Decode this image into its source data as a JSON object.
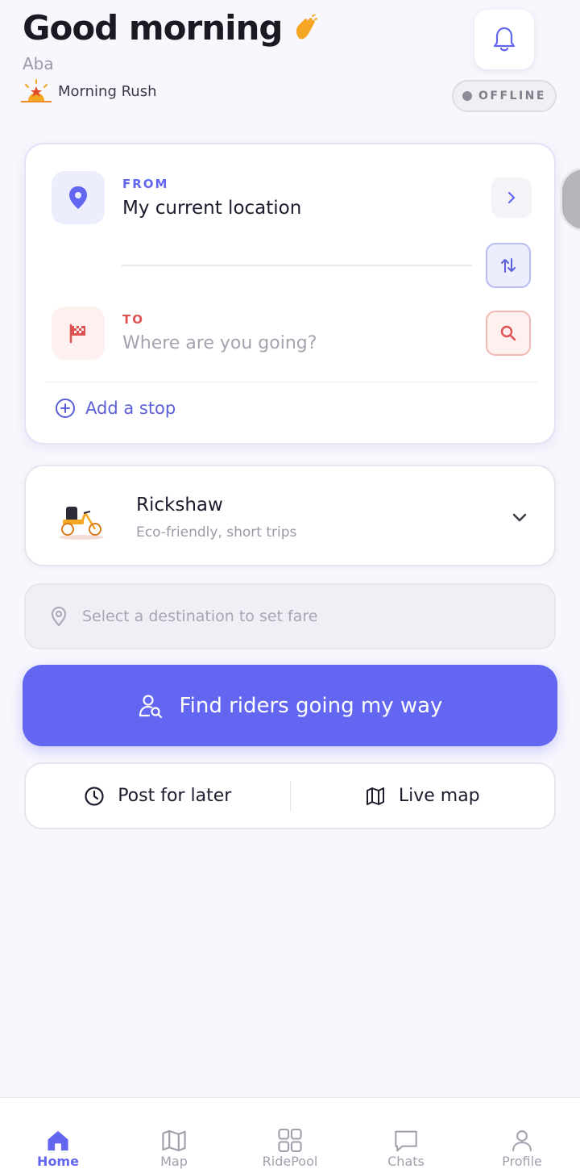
{
  "header": {
    "greeting": "Good morning",
    "user_name": "Aba",
    "period_label": "Morning Rush",
    "status": "OFFLINE"
  },
  "route": {
    "from_kicker": "FROM",
    "from_value": "My current location",
    "to_kicker": "TO",
    "to_placeholder": "Where are you going?",
    "add_stop_label": "Add a stop"
  },
  "vehicle": {
    "name": "Rickshaw",
    "description": "Eco-friendly, short trips"
  },
  "fare": {
    "placeholder": "Select a destination to set fare"
  },
  "actions": {
    "primary_label": "Find riders going my way",
    "post_later_label": "Post for later",
    "live_map_label": "Live map"
  },
  "nav": {
    "items": [
      {
        "label": "Home",
        "icon": "home-icon",
        "active": true
      },
      {
        "label": "Map",
        "icon": "map-icon",
        "active": false
      },
      {
        "label": "RidePool",
        "icon": "grid-icon",
        "active": false
      },
      {
        "label": "Chats",
        "icon": "chat-icon",
        "active": false
      },
      {
        "label": "Profile",
        "icon": "user-icon",
        "active": false
      }
    ]
  },
  "colors": {
    "accent": "#6366f1",
    "danger": "#e05252",
    "background": "#f7f7fd"
  }
}
